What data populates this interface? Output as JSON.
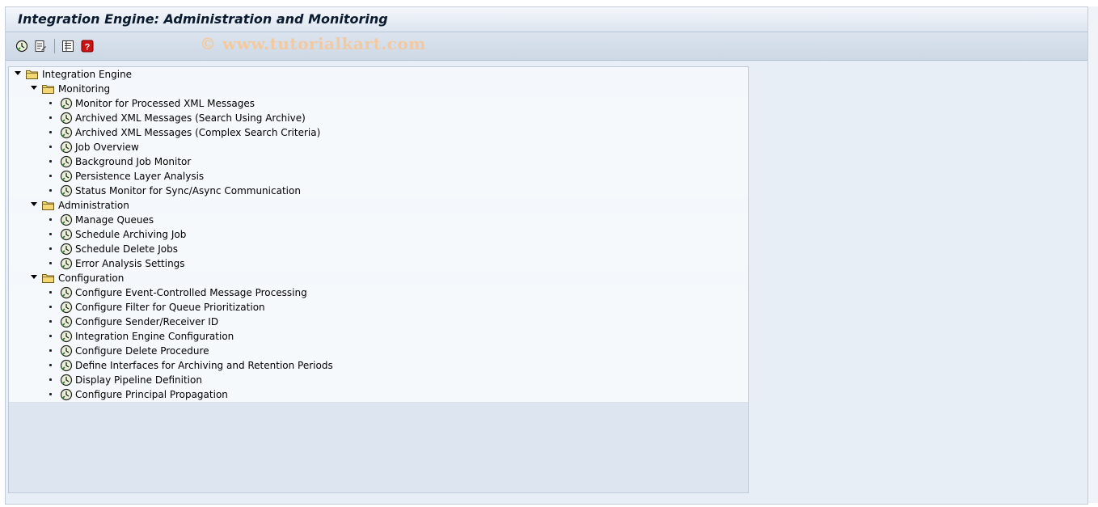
{
  "window": {
    "title": "Integration Engine: Administration and Monitoring",
    "watermark": "© www.tutorialkart.com"
  },
  "toolbar": {
    "buttons": [
      {
        "name": "execute-icon"
      },
      {
        "name": "variant-icon"
      },
      {
        "name": "list-icon"
      },
      {
        "name": "help-icon",
        "color": "#cc1111"
      }
    ]
  },
  "tree": {
    "root": {
      "label": "Integration Engine"
    },
    "groups": [
      {
        "label": "Monitoring",
        "items": [
          "Monitor for Processed XML Messages",
          "Archived XML Messages (Search Using Archive)",
          "Archived XML Messages (Complex Search Criteria)",
          "Job Overview",
          "Background Job Monitor",
          "Persistence Layer Analysis",
          "Status Monitor for Sync/Async Communication"
        ]
      },
      {
        "label": "Administration",
        "items": [
          "Manage Queues",
          "Schedule Archiving Job",
          "Schedule Delete Jobs",
          "Error Analysis Settings"
        ]
      },
      {
        "label": "Configuration",
        "items": [
          "Configure Event-Controlled Message Processing",
          "Configure Filter for Queue Prioritization",
          "Configure Sender/Receiver ID",
          "Integration Engine Configuration",
          "Configure Delete Procedure",
          "Define Interfaces for Archiving and Retention Periods",
          "Display Pipeline Definition",
          "Configure Principal Propagation"
        ]
      }
    ]
  },
  "colors": {
    "folder": "#f3d774",
    "exec_icon_fill": "#e8f0d8",
    "help_red": "#cc1111"
  }
}
